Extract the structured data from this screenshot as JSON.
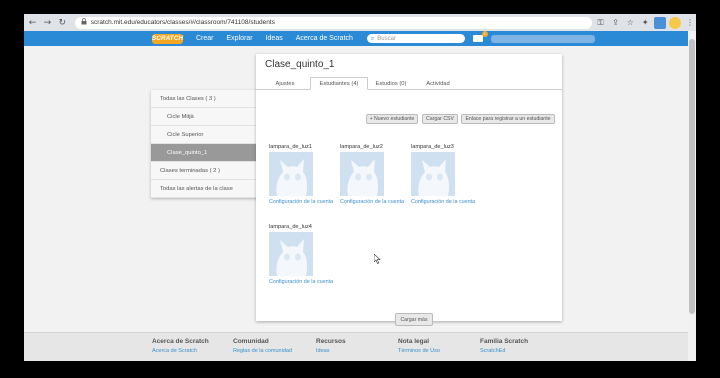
{
  "browser": {
    "back_glyph": "←",
    "forward_glyph": "→",
    "reload_glyph": "↻",
    "lock_glyph": "🔒",
    "url": "scratch.mit.edu/educators/classes/#/classroom/741108/students",
    "key_glyph": "⚿",
    "share_glyph": "⇪",
    "star_glyph": "☆",
    "puzzle_glyph": "✦",
    "sidepanel_glyph": "▮",
    "menu_glyph": "⋮"
  },
  "nav": {
    "logo_text": "SCRATCH",
    "links": [
      "Crear",
      "Explorar",
      "Ideas",
      "Acerca de Scratch"
    ],
    "search_icon_glyph": "⌕",
    "search_placeholder": "Buscar",
    "message_count": "1"
  },
  "sidebar": {
    "items": [
      {
        "label": "Todas las Clases ( 3 )",
        "level": "top",
        "active": false
      },
      {
        "label": "Cicle Mitjà",
        "level": "sub",
        "active": false
      },
      {
        "label": "Cicle Superior",
        "level": "sub",
        "active": false
      },
      {
        "label": "Clase_quinto_1",
        "level": "sub",
        "active": true
      },
      {
        "label": "Clases terminadas ( 2 )",
        "level": "top",
        "active": false
      },
      {
        "label": "Todas las alertas de la clase",
        "level": "top",
        "active": false
      }
    ]
  },
  "panel": {
    "title": "Clase_quinto_1",
    "tabs": [
      {
        "label": "Ajustes",
        "active": false
      },
      {
        "label": "Estudiantes (4)",
        "active": true
      },
      {
        "label": "Estudios (0)",
        "active": false
      },
      {
        "label": "Actividad",
        "active": false
      }
    ],
    "buttons": {
      "new_student": "+ Nuevo estudiante",
      "upload_csv": "Cargar CSV",
      "registration_link": "Enlace para registrar a un estudiante"
    },
    "students": [
      {
        "name": "lampara_de_luz1",
        "link": "Configuración de la cuenta"
      },
      {
        "name": "lampara_de_luz2",
        "link": "Configuración de la cuenta"
      },
      {
        "name": "lampara_de_luz3",
        "link": "Configuración de la cuenta"
      },
      {
        "name": "lampara_de_luz4",
        "link": "Configuración de la cuenta"
      }
    ],
    "load_more": "Cargar más"
  },
  "footer": {
    "columns": [
      {
        "heading": "Acerca de Scratch",
        "link": "Acerca de Scratch"
      },
      {
        "heading": "Comunidad",
        "link": "Reglas de la comunidad"
      },
      {
        "heading": "Recursos",
        "link": "Ideas"
      },
      {
        "heading": "Nota legal",
        "link": "Términos de Uso"
      },
      {
        "heading": "Familia Scratch",
        "link": "ScratchEd"
      }
    ]
  },
  "colors": {
    "nav_blue": "#2a8ad6",
    "logo_orange": "#f5a623",
    "link_blue": "#3a8fcd",
    "active_sidebar": "#999999"
  }
}
